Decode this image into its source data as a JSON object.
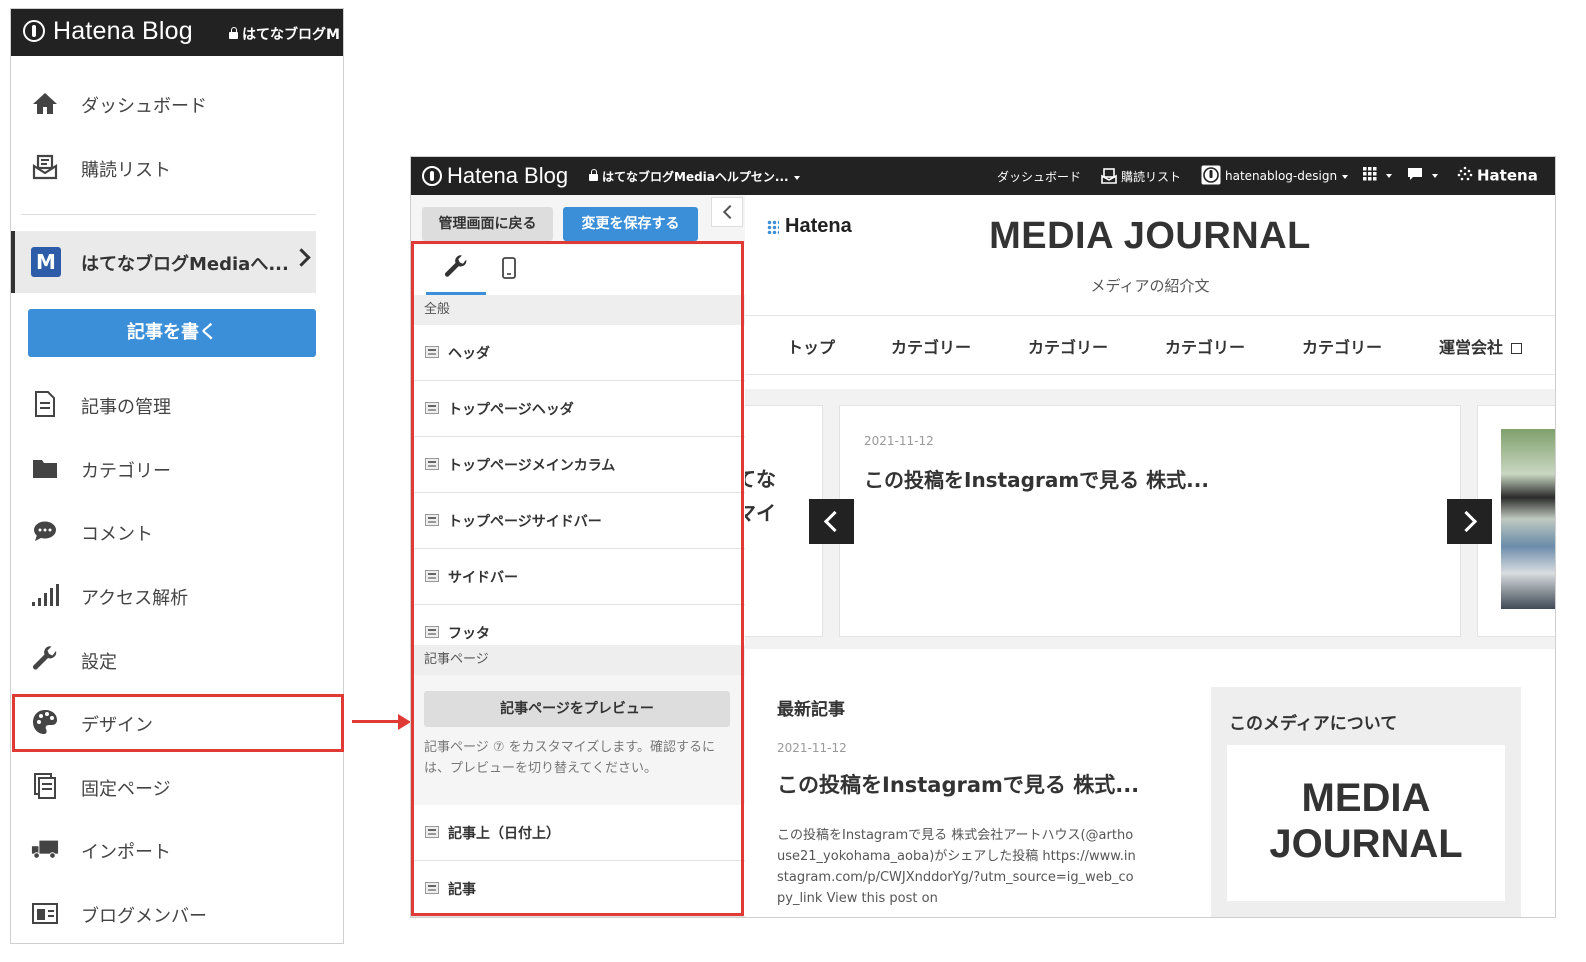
{
  "left_panel": {
    "logo": "Hatena Blog",
    "blog_name": "はてなブログM",
    "nav_top": [
      {
        "label": "ダッシュボード",
        "icon": "home-icon"
      },
      {
        "label": "購読リスト",
        "icon": "subscription-icon"
      }
    ],
    "blog_select_badge": "M",
    "blog_select_label": "はてなブログMediaへ...",
    "write_button": "記事を書く",
    "nav_items": [
      {
        "label": "記事の管理",
        "icon": "document-icon"
      },
      {
        "label": "カテゴリー",
        "icon": "folder-icon"
      },
      {
        "label": "コメント",
        "icon": "comment-icon"
      },
      {
        "label": "アクセス解析",
        "icon": "bar-chart-icon"
      },
      {
        "label": "設定",
        "icon": "wrench-icon"
      },
      {
        "label": "デザイン",
        "icon": "palette-icon"
      },
      {
        "label": "固定ページ",
        "icon": "pages-icon"
      },
      {
        "label": "インポート",
        "icon": "truck-icon"
      },
      {
        "label": "ブログメンバー",
        "icon": "member-icon"
      }
    ]
  },
  "topbar": {
    "logo": "Hatena Blog",
    "blog_name": "はてなブログMediaヘルプセン...",
    "dashboard": "ダッシュボード",
    "subscriptions": "購読リスト",
    "user": "hatenablog-design",
    "hatena": "Hatena"
  },
  "customize": {
    "back_button": "管理画面に戻る",
    "save_button": "変更を保存する",
    "section_general": "全般",
    "general_items": [
      "ヘッダ",
      "トップページヘッダ",
      "トップページメインカラム",
      "トップページサイドバー",
      "サイドバー",
      "フッタ"
    ],
    "section_article": "記事ページ",
    "preview_button": "記事ページをプレビュー",
    "preview_help": "記事ページ ⑦ をカスタマイズします。確認するには、プレビューを切り替えてください。",
    "article_items": [
      "記事上（日付上）",
      "記事"
    ]
  },
  "blog_preview": {
    "brand": "Hatena",
    "title": "MEDIA JOURNAL",
    "description": "メディアの紹介文",
    "nav": [
      "トップ",
      "カテゴリー",
      "カテゴリー",
      "カテゴリー",
      "カテゴリー",
      "運営会社"
    ],
    "slide_leftover_line1": "てな",
    "slide_leftover_line2": "マイ",
    "slide_date": "2021-11-12",
    "slide_title": "この投稿をInstagramで見る 株式...",
    "latest_heading": "最新記事",
    "post_date": "2021-11-12",
    "post_title": "この投稿をInstagramで見る 株式...",
    "post_body": "この投稿をInstagramで見る 株式会社アートハウス(@arthouse21_yokohama_aoba)がシェアした投稿 https://www.instagram.com/p/CWJXnddorYg/?utm_source=ig_web_copy_link View this post on",
    "sidebar_heading": "このメディアについて",
    "sidebar_logo_line1": "MEDIA",
    "sidebar_logo_line2": "JOURNAL"
  },
  "colors": {
    "accent": "#3b8ed8",
    "highlight": "#e03a36",
    "topbar": "#222222"
  }
}
